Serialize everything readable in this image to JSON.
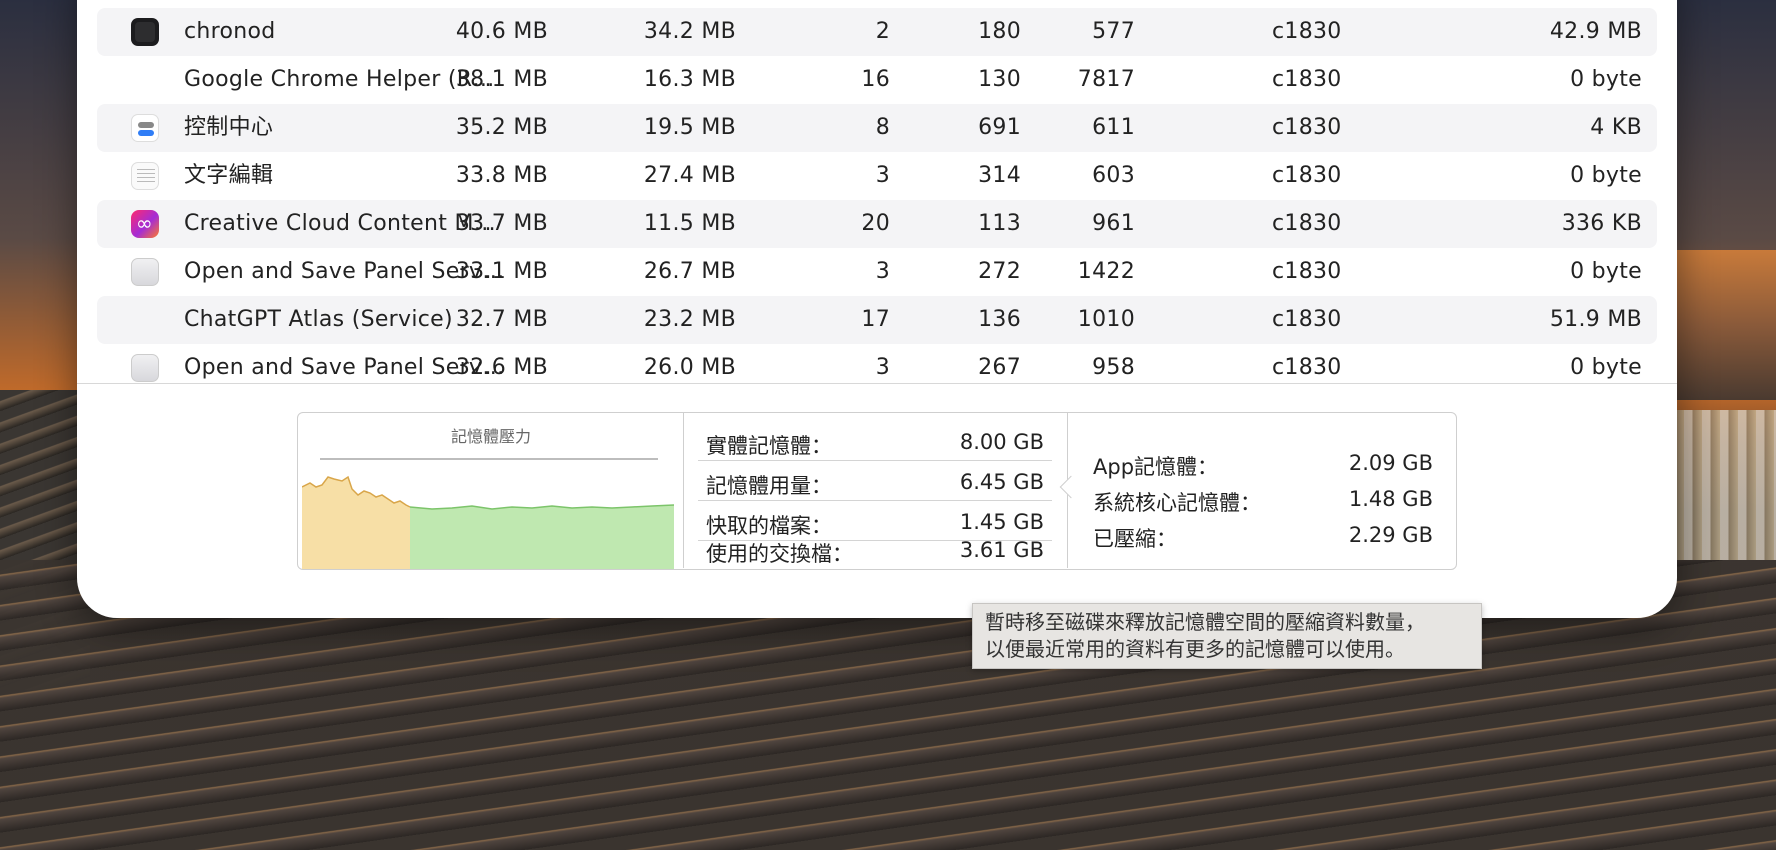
{
  "processes": [
    {
      "icon": "terminal-icon",
      "name": "chronod",
      "memory": "40.6 MB",
      "real_memory": "34.2 MB",
      "threads": "2",
      "ports": "180",
      "pid": "577",
      "user": "c1830",
      "purgeable": "42.9 MB"
    },
    {
      "icon": "",
      "name": "Google Chrome Helper (R…",
      "memory": "38.1 MB",
      "real_memory": "16.3 MB",
      "threads": "16",
      "ports": "130",
      "pid": "7817",
      "user": "c1830",
      "purgeable": "0 byte"
    },
    {
      "icon": "control-center-icon",
      "name": "控制中心",
      "memory": "35.2 MB",
      "real_memory": "19.5 MB",
      "threads": "8",
      "ports": "691",
      "pid": "611",
      "user": "c1830",
      "purgeable": "4 KB"
    },
    {
      "icon": "textedit-icon",
      "name": "文字編輯",
      "memory": "33.8 MB",
      "real_memory": "27.4 MB",
      "threads": "3",
      "ports": "314",
      "pid": "603",
      "user": "c1830",
      "purgeable": "0 byte"
    },
    {
      "icon": "creative-cloud-icon",
      "name": "Creative Cloud Content M…",
      "memory": "33.7 MB",
      "real_memory": "11.5 MB",
      "threads": "20",
      "ports": "113",
      "pid": "961",
      "user": "c1830",
      "purgeable": "336 KB"
    },
    {
      "icon": "box-icon",
      "name": "Open and Save Panel Serv…",
      "memory": "33.1 MB",
      "real_memory": "26.7 MB",
      "threads": "3",
      "ports": "272",
      "pid": "1422",
      "user": "c1830",
      "purgeable": "0 byte"
    },
    {
      "icon": "",
      "name": "ChatGPT Atlas (Service)",
      "memory": "32.7 MB",
      "real_memory": "23.2 MB",
      "threads": "17",
      "ports": "136",
      "pid": "1010",
      "user": "c1830",
      "purgeable": "51.9 MB"
    },
    {
      "icon": "box-icon",
      "name": "Open and Save Panel Serv…",
      "memory": "32.6 MB",
      "real_memory": "26.0 MB",
      "threads": "3",
      "ports": "267",
      "pid": "958",
      "user": "c1830",
      "purgeable": "0 byte"
    }
  ],
  "memory_pressure": {
    "title": "記憶體壓力",
    "colors": {
      "warning": "#f7dfa6",
      "warning_line": "#d9a64a",
      "normal": "#bfe8b0",
      "normal_line": "#7cc46a"
    }
  },
  "stats": {
    "physical_label": "實體記憶體：",
    "physical_value": "8.00 GB",
    "used_label": "記憶體用量：",
    "used_value": "6.45 GB",
    "cached_label": "快取的檔案：",
    "cached_value": "1.45 GB",
    "swap_label": "使用的交換檔：",
    "swap_value": "3.61 GB"
  },
  "detail": {
    "app_label": "App記憶體：",
    "app_value": "2.09 GB",
    "wired_label": "系統核心記憶體：",
    "wired_value": "1.48 GB",
    "compressed_label": "已壓縮：",
    "compressed_value": "2.29 GB"
  },
  "tooltip": {
    "line1": "暫時移至磁碟來釋放記憶體空間的壓縮資料數量，",
    "line2": "以便最近常用的資料有更多的記憶體可以使用。"
  }
}
